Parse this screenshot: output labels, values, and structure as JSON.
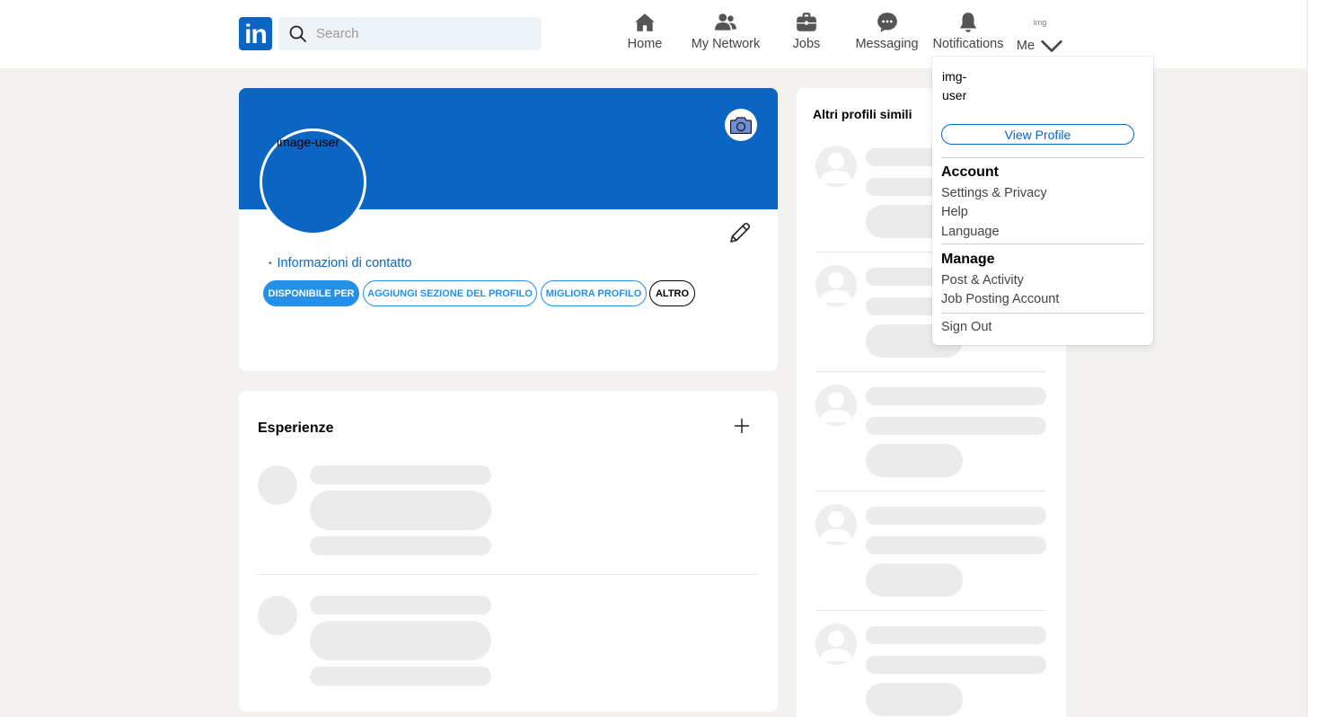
{
  "header": {
    "logo_text": "in",
    "search_placeholder": "Search",
    "nav": [
      {
        "label": "Home",
        "icon": "home-icon"
      },
      {
        "label": "My Network",
        "icon": "people-icon"
      },
      {
        "label": "Jobs",
        "icon": "briefcase-icon"
      },
      {
        "label": "Messaging",
        "icon": "chat-icon"
      },
      {
        "label": "Notifications",
        "icon": "bell-icon"
      },
      {
        "label": "Me",
        "icon": "chevron-down-icon"
      }
    ],
    "me_avatar_alt": "img"
  },
  "profile": {
    "avatar_alt": "image-user",
    "contact_link": "Informazioni di contatto",
    "chips": [
      "DISPONIBILE PER",
      "AGGIUNGI SEZIONE DEL PROFILO",
      "MIGLIORA PROFILO",
      "ALTRO"
    ]
  },
  "experience": {
    "title": "Esperienze"
  },
  "sidebar": {
    "title": "Altri profili simili"
  },
  "me_menu": {
    "avatar_alt_line1": "img-",
    "avatar_alt_line2": "user",
    "view_profile": "View Profile",
    "account_heading": "Account",
    "account_items": [
      "Settings & Privacy",
      "Help",
      "Language"
    ],
    "manage_heading": "Manage",
    "manage_items": [
      "Post & Activity",
      "Job Posting Account"
    ],
    "sign_out": "Sign Out"
  },
  "colors": {
    "brand": "#0a66c2",
    "page_bg": "#f3f2ef",
    "chip_blue": "#2490e8",
    "skeleton": "#ebebeb"
  }
}
